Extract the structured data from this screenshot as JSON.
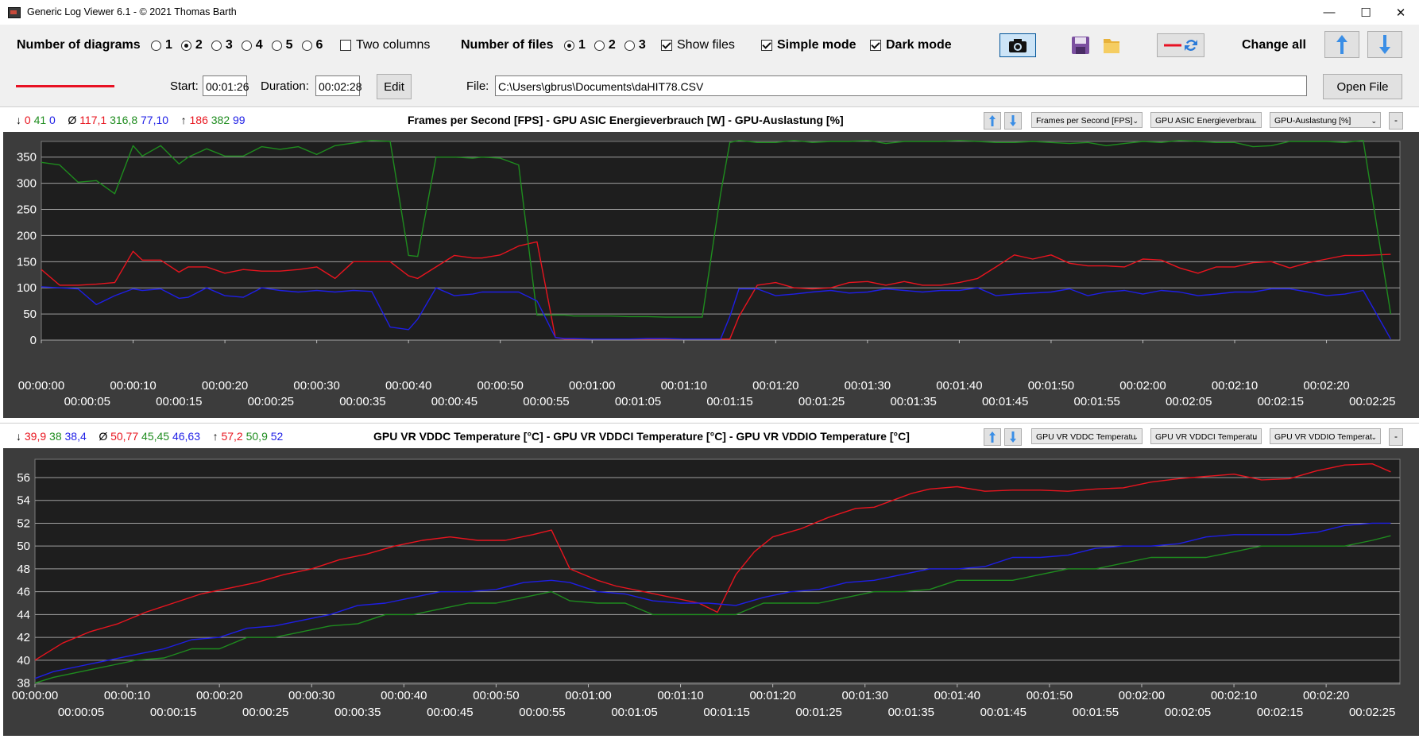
{
  "window": {
    "title": "Generic Log Viewer 6.1 - © 2021 Thomas Barth",
    "minimize_glyph": "—",
    "maximize_glyph": "☐",
    "close_glyph": "✕"
  },
  "toolbar": {
    "num_diagrams_label": "Number of diagrams",
    "diagram_options": [
      "1",
      "2",
      "3",
      "4",
      "5",
      "6"
    ],
    "diagram_selected": "2",
    "two_columns_label": "Two columns",
    "two_columns_checked": false,
    "num_files_label": "Number of files",
    "file_options": [
      "1",
      "2",
      "3"
    ],
    "file_selected": "1",
    "show_files_label": "Show files",
    "show_files_checked": true,
    "simple_mode_label": "Simple mode",
    "simple_mode_checked": true,
    "dark_mode_label": "Dark mode",
    "dark_mode_checked": true,
    "change_all_label": "Change all",
    "icons": [
      "camera-icon",
      "save-icon",
      "folder-icon",
      "line-color-swap-icon",
      "arrow-up-icon",
      "arrow-down-icon"
    ],
    "start_label": "Start:",
    "start_value": "00:01:26",
    "duration_label": "Duration:",
    "duration_value": "00:02:28",
    "edit_label": "Edit",
    "file_label": "File:",
    "file_path": "C:\\Users\\gbrus\\Documents\\daHIT78.CSV",
    "open_file_label": "Open File",
    "line_color": "#e81123"
  },
  "colors": {
    "red": "#e8141e",
    "green": "#1e8c1e",
    "blue": "#1e1ee6",
    "plot_bg": "#1e1e1e",
    "grid": "#a0a0a0",
    "outer_bg": "#3c3c3c"
  },
  "diagrams": [
    {
      "stats": {
        "min_arrow": "↓",
        "min": [
          "0",
          "41",
          "0"
        ],
        "avg_symbol": "Ø",
        "avg": [
          "117,1",
          "316,8",
          "77,10"
        ],
        "max_arrow": "↑",
        "max": [
          "186",
          "382",
          "99"
        ]
      },
      "title": "Frames per Second [FPS]  -  GPU ASIC Energieverbrauch [W]  -  GPU-Auslastung [%]",
      "combos": [
        "Frames per Second [FPS]",
        "GPU ASIC Energieverbrau",
        "GPU-Auslastung [%]"
      ],
      "minus": "-"
    },
    {
      "stats": {
        "min_arrow": "↓",
        "min": [
          "39,9",
          "38",
          "38,4"
        ],
        "avg_symbol": "Ø",
        "avg": [
          "50,77",
          "45,45",
          "46,63"
        ],
        "max_arrow": "↑",
        "max": [
          "57,2",
          "50,9",
          "52"
        ]
      },
      "title": "GPU VR VDDC Temperature [°C]  -  GPU VR VDDCI Temperature [°C]  -  GPU VR VDDIO Temperature [°C]",
      "combos": [
        "GPU VR VDDC Temperatu",
        "GPU VR VDDCI Temperatu",
        "GPU VR VDDIO Temperat"
      ],
      "minus": "-"
    }
  ],
  "chart_data": [
    {
      "type": "line",
      "title": "Frames per Second [FPS]  -  GPU ASIC Energieverbrauch [W]  -  GPU-Auslastung [%]",
      "ylim": [
        0,
        380
      ],
      "yticks": [
        0,
        50,
        100,
        150,
        200,
        250,
        300,
        350
      ],
      "xlim": [
        0,
        148
      ],
      "xticks_upper": [
        "00:00:00",
        "00:00:10",
        "00:00:20",
        "00:00:30",
        "00:00:40",
        "00:00:50",
        "00:01:00",
        "00:01:10",
        "00:01:20",
        "00:01:30",
        "00:01:40",
        "00:01:50",
        "00:02:00",
        "00:02:10",
        "00:02:20"
      ],
      "xticks_lower": [
        "00:00:05",
        "00:00:15",
        "00:00:25",
        "00:00:35",
        "00:00:45",
        "00:00:55",
        "00:01:05",
        "00:01:15",
        "00:01:25",
        "00:01:35",
        "00:01:45",
        "00:01:55",
        "00:02:05",
        "00:02:15",
        "00:02:25"
      ],
      "grid": true,
      "series": [
        {
          "color": "red",
          "x": [
            0,
            2,
            4,
            6,
            8,
            10,
            11,
            13,
            15,
            16,
            18,
            20,
            22,
            24,
            26,
            28,
            30,
            32,
            34,
            36,
            38,
            40,
            41,
            43,
            45,
            47,
            48,
            50,
            52,
            54,
            56,
            57,
            58,
            60,
            62,
            64,
            66,
            68,
            70,
            72,
            74,
            75,
            76,
            78,
            80,
            82,
            84,
            86,
            88,
            90,
            92,
            94,
            96,
            98,
            100,
            102,
            104,
            106,
            108,
            110,
            112,
            114,
            116,
            118,
            120,
            122,
            124,
            126,
            128,
            130,
            132,
            134,
            136,
            138,
            140,
            142,
            144,
            147
          ],
          "y": [
            135,
            105,
            105,
            107,
            110,
            170,
            153,
            153,
            130,
            140,
            140,
            128,
            135,
            132,
            132,
            135,
            140,
            118,
            150,
            150,
            150,
            123,
            118,
            140,
            162,
            157,
            157,
            163,
            180,
            188,
            5,
            2,
            2,
            2,
            2,
            2,
            2,
            2,
            2,
            2,
            2,
            2,
            45,
            105,
            110,
            100,
            98,
            100,
            110,
            112,
            105,
            112,
            105,
            105,
            110,
            118,
            140,
            163,
            155,
            163,
            147,
            142,
            142,
            140,
            155,
            153,
            138,
            128,
            140,
            140,
            148,
            150,
            138,
            148,
            155,
            162,
            162,
            164
          ]
        },
        {
          "color": "green",
          "x": [
            0,
            2,
            4,
            6,
            8,
            10,
            11,
            13,
            15,
            16,
            18,
            20,
            22,
            24,
            26,
            28,
            30,
            32,
            34,
            36,
            38,
            40,
            41,
            43,
            45,
            47,
            48,
            50,
            52,
            54,
            56,
            57,
            58,
            60,
            62,
            64,
            66,
            68,
            70,
            72,
            74,
            75,
            76,
            78,
            80,
            82,
            84,
            86,
            88,
            90,
            92,
            94,
            96,
            98,
            100,
            102,
            104,
            106,
            108,
            110,
            112,
            114,
            116,
            118,
            120,
            122,
            124,
            126,
            128,
            130,
            132,
            134,
            136,
            138,
            140,
            142,
            144,
            147
          ],
          "y": [
            340,
            335,
            302,
            305,
            280,
            372,
            352,
            372,
            337,
            350,
            366,
            352,
            352,
            370,
            365,
            370,
            355,
            372,
            377,
            382,
            380,
            162,
            160,
            350,
            350,
            348,
            350,
            348,
            335,
            48,
            48,
            48,
            46,
            46,
            46,
            45,
            45,
            44,
            44,
            44,
            280,
            378,
            382,
            378,
            378,
            382,
            378,
            380,
            380,
            382,
            376,
            380,
            380,
            380,
            382,
            380,
            378,
            378,
            380,
            378,
            376,
            378,
            372,
            376,
            380,
            378,
            382,
            380,
            378,
            378,
            370,
            372,
            380,
            380,
            380,
            378,
            382,
            50
          ]
        },
        {
          "color": "blue",
          "x": [
            0,
            2,
            4,
            6,
            8,
            10,
            11,
            13,
            15,
            16,
            18,
            20,
            22,
            24,
            26,
            28,
            30,
            32,
            34,
            36,
            38,
            40,
            41,
            43,
            45,
            47,
            48,
            50,
            52,
            54,
            56,
            57,
            58,
            60,
            62,
            64,
            66,
            68,
            70,
            72,
            74,
            75,
            76,
            78,
            80,
            82,
            84,
            86,
            88,
            90,
            92,
            94,
            96,
            98,
            100,
            102,
            104,
            106,
            108,
            110,
            112,
            114,
            116,
            118,
            120,
            122,
            124,
            126,
            128,
            130,
            132,
            134,
            136,
            138,
            140,
            142,
            144,
            147
          ],
          "y": [
            102,
            100,
            98,
            68,
            85,
            98,
            95,
            98,
            80,
            82,
            100,
            85,
            82,
            100,
            95,
            92,
            95,
            92,
            95,
            93,
            25,
            20,
            40,
            100,
            85,
            88,
            92,
            92,
            92,
            75,
            5,
            3,
            3,
            2,
            2,
            2,
            3,
            3,
            2,
            2,
            2,
            45,
            98,
            98,
            85,
            88,
            92,
            95,
            90,
            92,
            98,
            95,
            92,
            95,
            95,
            100,
            85,
            88,
            90,
            92,
            98,
            85,
            92,
            95,
            88,
            95,
            92,
            85,
            88,
            92,
            92,
            98,
            98,
            92,
            85,
            88,
            95,
            2
          ]
        }
      ]
    },
    {
      "type": "line",
      "title": "GPU VR VDDC Temperature [°C]  -  GPU VR VDDCI Temperature [°C]  -  GPU VR VDDIO Temperature [°C]",
      "ylim": [
        37.9,
        57.6
      ],
      "yticks": [
        38,
        40,
        42,
        44,
        46,
        48,
        50,
        52,
        54,
        56
      ],
      "xlim": [
        0,
        148
      ],
      "xticks_upper": [
        "00:00:00",
        "00:00:10",
        "00:00:20",
        "00:00:30",
        "00:00:40",
        "00:00:50",
        "00:01:00",
        "00:01:10",
        "00:01:20",
        "00:01:30",
        "00:01:40",
        "00:01:50",
        "00:02:00",
        "00:02:10",
        "00:02:20"
      ],
      "xticks_lower": [
        "00:00:05",
        "00:00:15",
        "00:00:25",
        "00:00:35",
        "00:00:45",
        "00:00:55",
        "00:01:05",
        "00:01:15",
        "00:01:25",
        "00:01:35",
        "00:01:45",
        "00:01:55",
        "00:02:05",
        "00:02:15",
        "00:02:25"
      ],
      "grid": true,
      "series": [
        {
          "color": "red",
          "x": [
            0,
            3,
            6,
            9,
            12,
            15,
            18,
            21,
            24,
            27,
            30,
            33,
            36,
            39,
            42,
            45,
            48,
            51,
            54,
            56,
            58,
            61,
            63,
            66,
            69,
            72,
            74,
            76,
            78,
            80,
            83,
            86,
            89,
            91,
            93,
            95,
            97,
            100,
            103,
            106,
            109,
            112,
            115,
            118,
            121,
            124,
            127,
            130,
            133,
            136,
            139,
            142,
            145,
            147
          ],
          "y": [
            40,
            41.5,
            42.5,
            43.2,
            44.2,
            45.0,
            45.8,
            46.3,
            46.8,
            47.5,
            48.0,
            48.8,
            49.3,
            50.0,
            50.5,
            50.8,
            50.5,
            50.5,
            51.0,
            51.4,
            48.0,
            47.0,
            46.5,
            46.0,
            45.5,
            45.0,
            44.2,
            47.5,
            49.5,
            50.8,
            51.5,
            52.5,
            53.3,
            53.4,
            54.0,
            54.6,
            55.0,
            55.2,
            54.8,
            54.9,
            54.9,
            54.8,
            55.0,
            55.1,
            55.6,
            55.9,
            56.1,
            56.3,
            55.8,
            55.9,
            56.6,
            57.1,
            57.2,
            56.5
          ]
        },
        {
          "color": "green",
          "x": [
            0,
            2,
            5,
            8,
            11,
            14,
            17,
            20,
            23,
            26,
            29,
            32,
            35,
            38,
            41,
            44,
            47,
            50,
            53,
            56,
            58,
            61,
            64,
            67,
            70,
            73,
            76,
            79,
            82,
            85,
            88,
            91,
            94,
            97,
            100,
            103,
            106,
            109,
            112,
            115,
            118,
            121,
            124,
            127,
            130,
            133,
            136,
            139,
            142,
            145,
            147
          ],
          "y": [
            38,
            38.5,
            39,
            39.5,
            40,
            40.2,
            41,
            41,
            42,
            42,
            42.5,
            43,
            43.2,
            44,
            44,
            44.5,
            45,
            45,
            45.5,
            46,
            45.2,
            45,
            45,
            44,
            44,
            44,
            44,
            45,
            45,
            45,
            45.5,
            46,
            46,
            46.2,
            47,
            47,
            47,
            47.5,
            48,
            48,
            48.5,
            49,
            49,
            49,
            49.5,
            50,
            50,
            50,
            50,
            50.5,
            50.9
          ]
        },
        {
          "color": "blue",
          "x": [
            0,
            2,
            5,
            8,
            11,
            14,
            17,
            20,
            23,
            26,
            29,
            32,
            35,
            38,
            41,
            44,
            47,
            50,
            53,
            56,
            58,
            61,
            64,
            67,
            70,
            73,
            76,
            79,
            82,
            85,
            88,
            91,
            94,
            97,
            100,
            103,
            106,
            109,
            112,
            115,
            118,
            121,
            124,
            127,
            130,
            133,
            136,
            139,
            142,
            145,
            147
          ],
          "y": [
            38.4,
            39,
            39.5,
            40,
            40.5,
            41,
            41.8,
            42,
            42.8,
            43,
            43.5,
            44,
            44.8,
            45,
            45.5,
            46,
            46,
            46.2,
            46.8,
            47,
            46.8,
            46,
            45.8,
            45.2,
            45,
            45,
            44.8,
            45.5,
            46,
            46.2,
            46.8,
            47,
            47.5,
            48,
            48,
            48.2,
            49,
            49,
            49.2,
            49.8,
            50,
            50,
            50.2,
            50.8,
            51,
            51,
            51,
            51.2,
            51.8,
            52,
            52
          ]
        }
      ]
    }
  ]
}
